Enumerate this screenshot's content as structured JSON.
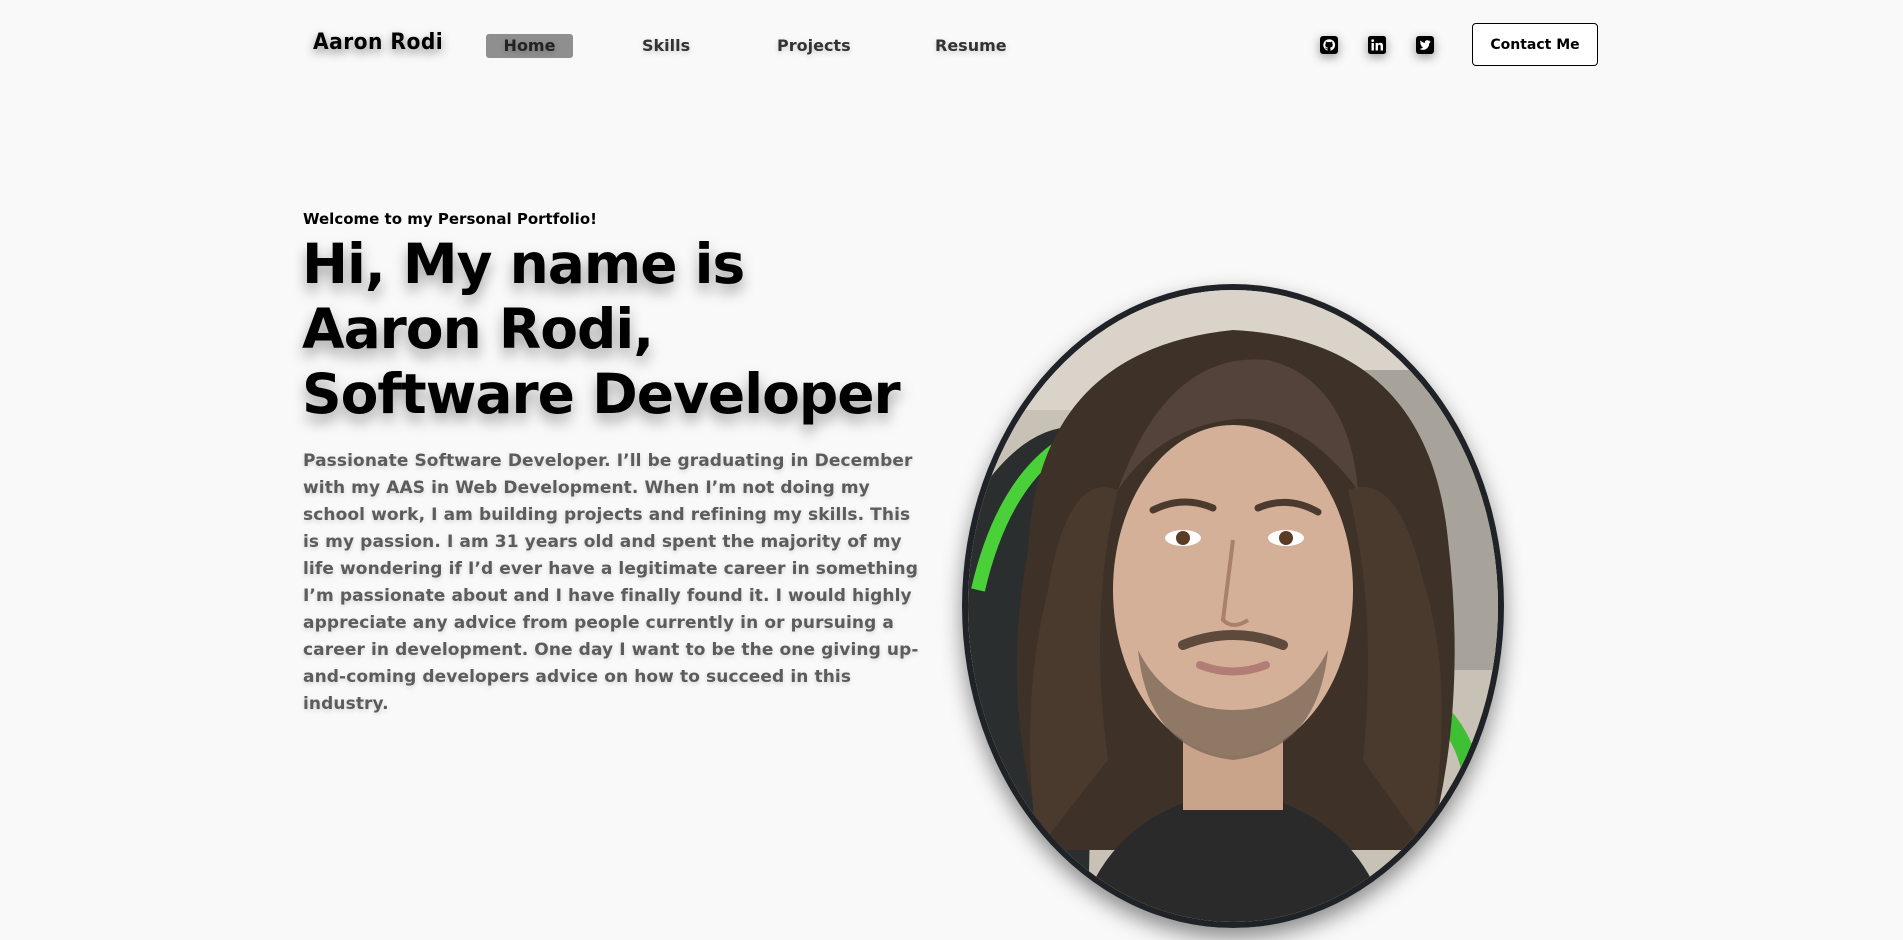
{
  "brand": "Aaron Rodi",
  "nav": {
    "items": [
      {
        "label": "Home",
        "active": true
      },
      {
        "label": "Skills",
        "active": false
      },
      {
        "label": "Projects",
        "active": false
      },
      {
        "label": "Resume",
        "active": false
      }
    ]
  },
  "social": [
    {
      "icon": "github-icon"
    },
    {
      "icon": "linkedin-icon"
    },
    {
      "icon": "twitter-icon"
    }
  ],
  "contact_button": "Contact Me",
  "hero": {
    "welcome": "Welcome to my Personal Portfolio!",
    "headline_lines": [
      "Hi, My name is",
      "Aaron Rodi,",
      "Software Developer"
    ],
    "bio": "Passionate Software Developer. I’ll be graduating in December with my AAS in Web Development. When I’m not doing my school work, I am building projects and refining my skills. This is my passion. I am 31 years old and spent the majority of my life wondering if I’d ever have a legitimate career in something I’m passionate about and I have finally found it. I would highly appreciate any advice from people currently in or pursuing a career in development. One day I want to be the one giving up-and-coming developers advice on how to succeed in this industry."
  },
  "colors": {
    "background": "#f9f9f9",
    "active_nav": "#8f8f8f",
    "bio_text": "#5c5c5c",
    "portrait_border": "#1f2328"
  }
}
